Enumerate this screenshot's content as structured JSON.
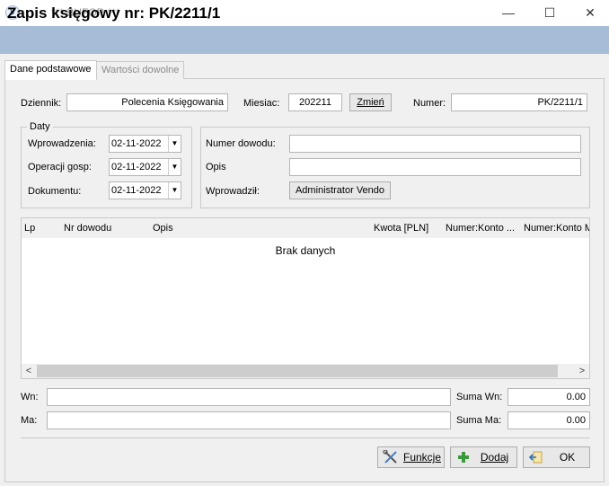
{
  "window": {
    "title": "*** BUFOR ***",
    "icon_letter": "v",
    "minimize_glyph": "—",
    "maximize_glyph": "☐",
    "close_glyph": "✕"
  },
  "header": {
    "title": "Zapis księgowy nr: PK/2211/1"
  },
  "tabs": [
    {
      "label": "Dane podstawowe",
      "active": true
    },
    {
      "label": "Wartości dowolne",
      "active": false
    }
  ],
  "top_row": {
    "dziennik_label": "Dziennik:",
    "dziennik_value": "Polecenia Księgowania",
    "miesiac_label": "Miesiac:",
    "miesiac_value": "202211",
    "zmien_label": "Zmień",
    "numer_label": "Numer:",
    "numer_value": "PK/2211/1"
  },
  "daty": {
    "legend": "Daty",
    "wprowadzenia_label": "Wprowadzenia:",
    "wprowadzenia_value": "02-11-2022",
    "operacji_label": "Operacji gosp:",
    "operacji_value": "02-11-2022",
    "dokumentu_label": "Dokumentu:",
    "dokumentu_value": "02-11-2022",
    "dropdown_glyph": "▼"
  },
  "details": {
    "numer_dowodu_label": "Numer dowodu:",
    "numer_dowodu_value": "",
    "opis_label": "Opis",
    "opis_value": "",
    "wprowadzil_label": "Wprowadził:",
    "wprowadzil_value": "Administrator Vendo"
  },
  "grid": {
    "columns": [
      "Lp",
      "Nr dowodu",
      "Opis",
      "Kwota [PLN]",
      "Numer:Konto ...",
      "Numer:Konto M"
    ],
    "empty_text": "Brak danych",
    "scroll_left": "<",
    "scroll_right": ">"
  },
  "totals": {
    "wn_label": "Wn:",
    "wn_value": "",
    "ma_label": "Ma:",
    "ma_value": "",
    "suma_wn_label": "Suma Wn:",
    "suma_wn_value": "0.00",
    "suma_ma_label": "Suma Ma:",
    "suma_ma_value": "0.00"
  },
  "buttons": {
    "funkcje_label": "Funkcje",
    "dodaj_label": "Dodaj",
    "ok_label": "OK"
  },
  "colors": {
    "header_bg": "#a7bcd7",
    "add_icon": "#3c9a3c"
  }
}
